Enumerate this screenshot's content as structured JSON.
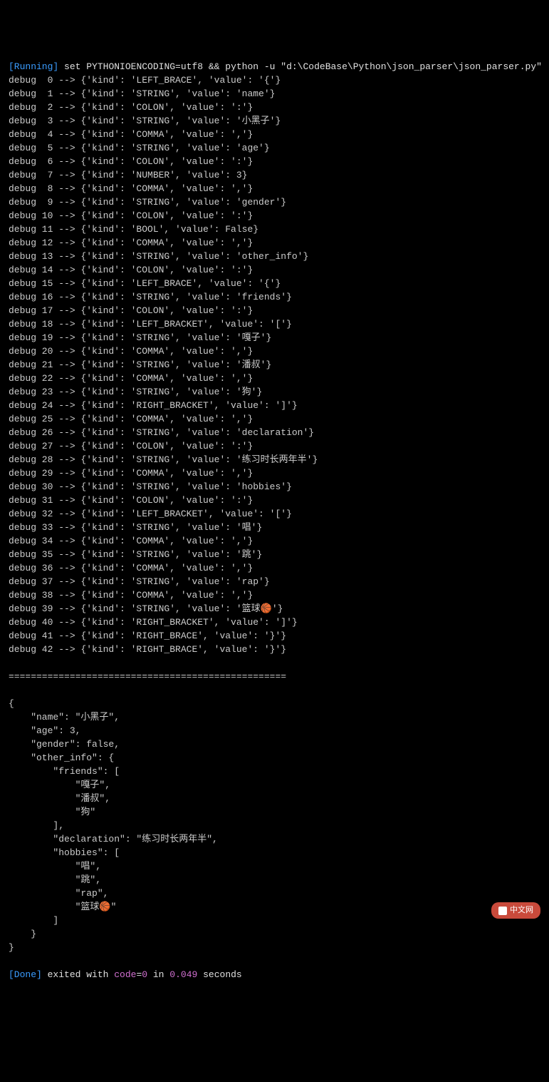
{
  "header": {
    "running_label": "[Running]",
    "command": "set PYTHONIOENCODING=utf8 && python -u \"d:\\CodeBase\\Python\\json_parser\\json_parser.py\""
  },
  "tokens": [
    {
      "idx": " 0",
      "kind": "LEFT_BRACE",
      "value": "'{'"
    },
    {
      "idx": " 1",
      "kind": "STRING",
      "value": "'name'"
    },
    {
      "idx": " 2",
      "kind": "COLON",
      "value": "':'"
    },
    {
      "idx": " 3",
      "kind": "STRING",
      "value": "'小黑子'"
    },
    {
      "idx": " 4",
      "kind": "COMMA",
      "value": "','"
    },
    {
      "idx": " 5",
      "kind": "STRING",
      "value": "'age'"
    },
    {
      "idx": " 6",
      "kind": "COLON",
      "value": "':'"
    },
    {
      "idx": " 7",
      "kind": "NUMBER",
      "value": "3"
    },
    {
      "idx": " 8",
      "kind": "COMMA",
      "value": "','"
    },
    {
      "idx": " 9",
      "kind": "STRING",
      "value": "'gender'"
    },
    {
      "idx": "10",
      "kind": "COLON",
      "value": "':'"
    },
    {
      "idx": "11",
      "kind": "BOOL",
      "value": "False"
    },
    {
      "idx": "12",
      "kind": "COMMA",
      "value": "','"
    },
    {
      "idx": "13",
      "kind": "STRING",
      "value": "'other_info'"
    },
    {
      "idx": "14",
      "kind": "COLON",
      "value": "':'"
    },
    {
      "idx": "15",
      "kind": "LEFT_BRACE",
      "value": "'{'"
    },
    {
      "idx": "16",
      "kind": "STRING",
      "value": "'friends'"
    },
    {
      "idx": "17",
      "kind": "COLON",
      "value": "':'"
    },
    {
      "idx": "18",
      "kind": "LEFT_BRACKET",
      "value": "'['"
    },
    {
      "idx": "19",
      "kind": "STRING",
      "value": "'嘎子'"
    },
    {
      "idx": "20",
      "kind": "COMMA",
      "value": "','"
    },
    {
      "idx": "21",
      "kind": "STRING",
      "value": "'潘叔'"
    },
    {
      "idx": "22",
      "kind": "COMMA",
      "value": "','"
    },
    {
      "idx": "23",
      "kind": "STRING",
      "value": "'狗'"
    },
    {
      "idx": "24",
      "kind": "RIGHT_BRACKET",
      "value": "']'"
    },
    {
      "idx": "25",
      "kind": "COMMA",
      "value": "','"
    },
    {
      "idx": "26",
      "kind": "STRING",
      "value": "'declaration'"
    },
    {
      "idx": "27",
      "kind": "COLON",
      "value": "':'"
    },
    {
      "idx": "28",
      "kind": "STRING",
      "value": "'练习时长两年半'"
    },
    {
      "idx": "29",
      "kind": "COMMA",
      "value": "','"
    },
    {
      "idx": "30",
      "kind": "STRING",
      "value": "'hobbies'"
    },
    {
      "idx": "31",
      "kind": "COLON",
      "value": "':'"
    },
    {
      "idx": "32",
      "kind": "LEFT_BRACKET",
      "value": "'['"
    },
    {
      "idx": "33",
      "kind": "STRING",
      "value": "'唱'"
    },
    {
      "idx": "34",
      "kind": "COMMA",
      "value": "','"
    },
    {
      "idx": "35",
      "kind": "STRING",
      "value": "'跳'"
    },
    {
      "idx": "36",
      "kind": "COMMA",
      "value": "','"
    },
    {
      "idx": "37",
      "kind": "STRING",
      "value": "'rap'"
    },
    {
      "idx": "38",
      "kind": "COMMA",
      "value": "','"
    },
    {
      "idx": "39",
      "kind": "STRING",
      "value": "'篮球🏀'"
    },
    {
      "idx": "40",
      "kind": "RIGHT_BRACKET",
      "value": "']'"
    },
    {
      "idx": "41",
      "kind": "RIGHT_BRACE",
      "value": "'}'"
    },
    {
      "idx": "42",
      "kind": "RIGHT_BRACE",
      "value": "'}'"
    }
  ],
  "separator": "==================================================",
  "json_output": {
    "lines": [
      "{",
      "    \"name\": \"小黑子\",",
      "    \"age\": 3,",
      "    \"gender\": false,",
      "    \"other_info\": {",
      "        \"friends\": [",
      "            \"嘎子\",",
      "            \"潘叔\",",
      "            \"狗\"",
      "        ],",
      "        \"declaration\": \"练习时长两年半\",",
      "        \"hobbies\": [",
      "            \"唱\",",
      "            \"跳\",",
      "            \"rap\",",
      "            \"篮球🏀\"",
      "        ]",
      "    }",
      "}"
    ]
  },
  "footer": {
    "done_label": "[Done]",
    "exited_text": " exited with ",
    "code_label": "code",
    "equals": "=",
    "code_value": "0",
    "in_text": " in ",
    "time_value": "0.049",
    "seconds_text": " seconds"
  },
  "watermark": {
    "text": "中文网"
  }
}
